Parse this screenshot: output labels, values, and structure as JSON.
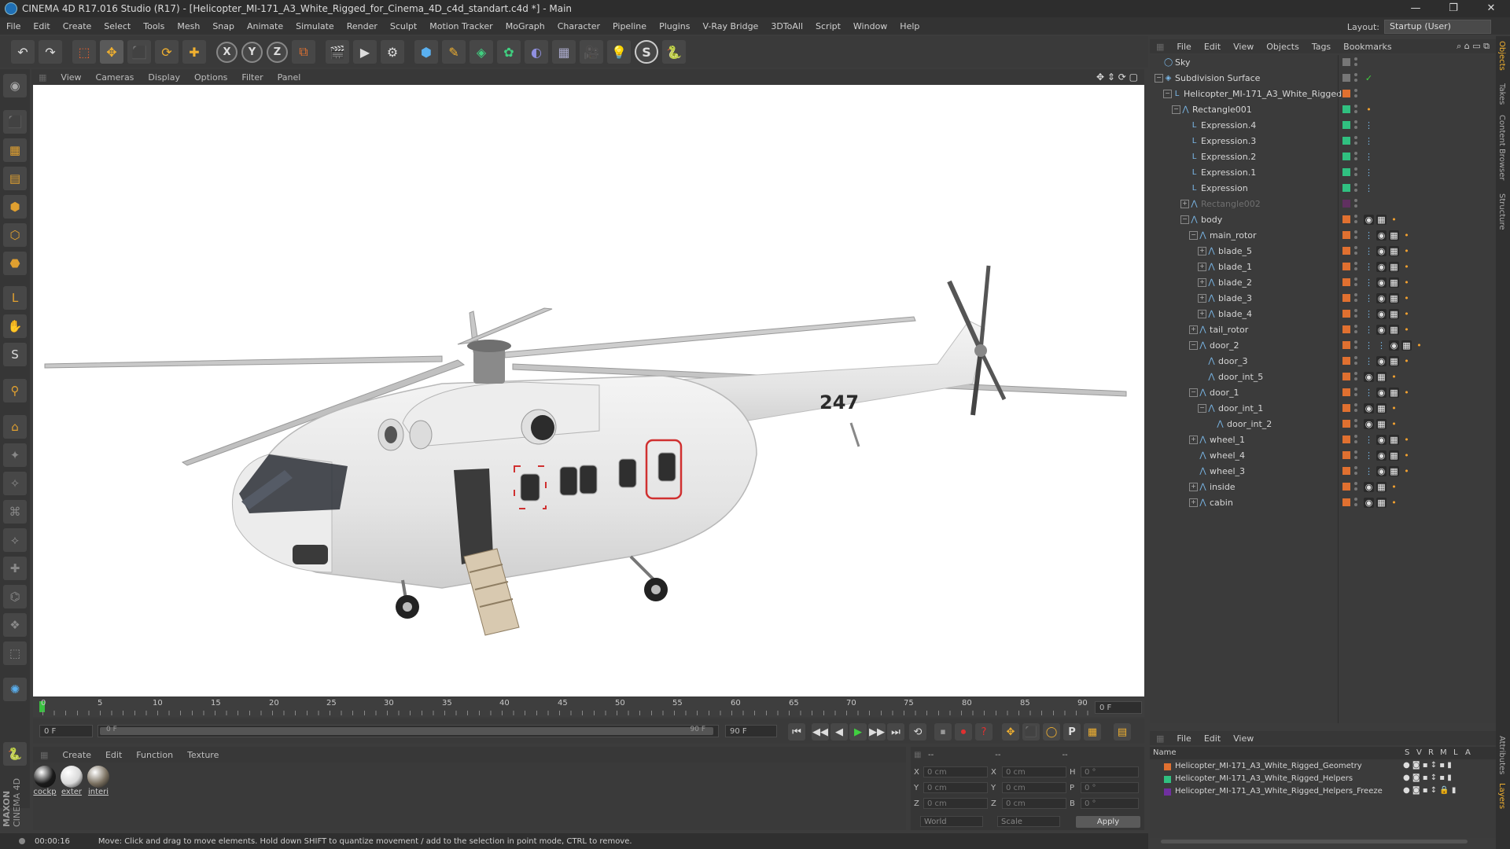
{
  "window": {
    "title": "CINEMA 4D R17.016 Studio (R17) - [Helicopter_MI-171_A3_White_Rigged_for_Cinema_4D_c4d_standart.c4d *] - Main",
    "minimize": "—",
    "restore": "❐",
    "close": "✕"
  },
  "menubar": {
    "items": [
      "File",
      "Edit",
      "Create",
      "Select",
      "Tools",
      "Mesh",
      "Snap",
      "Animate",
      "Simulate",
      "Render",
      "Sculpt",
      "Motion Tracker",
      "MoGraph",
      "Character",
      "Pipeline",
      "Plugins",
      "V-Ray Bridge",
      "3DToAll",
      "Script",
      "Window",
      "Help"
    ],
    "layout_label": "Layout:",
    "layout_value": "Startup (User)"
  },
  "toolbar": {
    "undo": "↶",
    "redo": "↷",
    "select": "⬚",
    "move": "✥",
    "scale": "⬛",
    "rotate": "⟳",
    "add": "✚",
    "x": "X",
    "y": "Y",
    "z": "Z",
    "coord": "⧉",
    "render_view": "🎬",
    "render": "▶",
    "render_settings": "⚙",
    "cube": "⬢",
    "pen": "✎",
    "subdiv": "◈",
    "array": "✿",
    "deformer": "◐",
    "floor": "▦",
    "camera": "🎥",
    "light": "💡",
    "vray": "S",
    "python": "🐍"
  },
  "left_tools": [
    "◉",
    "⬛",
    "▦",
    "▤",
    "⬢",
    "⬡",
    "⬣",
    "L",
    "✋",
    "S",
    "⚲",
    "⌂",
    "✦",
    "✧",
    "⌘",
    "⟡",
    "✚",
    "⌬",
    "❖",
    "⬚",
    "✺",
    "🐍"
  ],
  "viewport": {
    "menu": [
      "View",
      "Cameras",
      "Display",
      "Options",
      "Filter",
      "Panel"
    ],
    "nav_icons": "✥ ⇕ ⟳ ▢",
    "tail_number": "247"
  },
  "timeline": {
    "ticks": [
      "0",
      "5",
      "10",
      "15",
      "20",
      "25",
      "30",
      "35",
      "40",
      "45",
      "50",
      "55",
      "60",
      "65",
      "70",
      "75",
      "80",
      "85",
      "90"
    ],
    "frame_field": "0 F"
  },
  "transport": {
    "start_field": "0 F",
    "range_start": "0 F",
    "range_end": "90 F",
    "end_field": "90 F",
    "buttons": [
      "⏮",
      "◀◀",
      "◀",
      "▶",
      "▶▶",
      "⏭",
      "⟲",
      "⏹",
      "⏺",
      "?",
      "✥",
      "⬛",
      "◯",
      "P",
      "▦",
      "▤"
    ]
  },
  "materials": {
    "menu": [
      "Create",
      "Edit",
      "Function",
      "Texture"
    ],
    "items": [
      {
        "label": "cockp",
        "color": "#1a1a1a"
      },
      {
        "label": "exter",
        "color": "#d8d8d8"
      },
      {
        "label": "interi",
        "color": "#7a7060"
      }
    ]
  },
  "coords": {
    "header": [
      "--",
      "--",
      "--"
    ],
    "rows": [
      {
        "a": "X",
        "av": "0 cm",
        "b": "X",
        "bv": "0 cm",
        "c": "H",
        "cv": "0 °"
      },
      {
        "a": "Y",
        "av": "0 cm",
        "b": "Y",
        "bv": "0 cm",
        "c": "P",
        "cv": "0 °"
      },
      {
        "a": "Z",
        "av": "0 cm",
        "b": "Z",
        "bv": "0 cm",
        "c": "B",
        "cv": "0 °"
      }
    ],
    "world": "World",
    "scale": "Scale",
    "apply": "Apply"
  },
  "status": {
    "time": "00:00:16",
    "message": "Move: Click and drag to move elements. Hold down SHIFT to quantize movement / add to the selection in point mode, CTRL to remove."
  },
  "brand": {
    "line1": "MAXON",
    "line2": "CINEMA 4D"
  },
  "object_manager": {
    "menu": [
      "File",
      "Edit",
      "View",
      "Objects",
      "Tags",
      "Bookmarks"
    ],
    "rows": [
      {
        "name": "Sky",
        "indent": 0,
        "exp": "",
        "icon": "◯",
        "sw": "#777777",
        "tags": []
      },
      {
        "name": "Subdivision Surface",
        "indent": 0,
        "exp": "−",
        "icon": "◈",
        "sw": "#777777",
        "tags": [
          "✓"
        ]
      },
      {
        "name": "Helicopter_MI-171_A3_White_Rigged",
        "indent": 1,
        "exp": "−",
        "icon": "L",
        "sw": "#e07030",
        "tags": []
      },
      {
        "name": "Rectangle001",
        "indent": 2,
        "exp": "−",
        "icon": "⋀",
        "sw": "#30c080",
        "tags": [
          "•"
        ]
      },
      {
        "name": "Expression.4",
        "indent": 3,
        "exp": "",
        "icon": "L",
        "sw": "#30c080",
        "tags": [
          "⋮"
        ]
      },
      {
        "name": "Expression.3",
        "indent": 3,
        "exp": "",
        "icon": "L",
        "sw": "#30c080",
        "tags": [
          "⋮"
        ]
      },
      {
        "name": "Expression.2",
        "indent": 3,
        "exp": "",
        "icon": "L",
        "sw": "#30c080",
        "tags": [
          "⋮"
        ]
      },
      {
        "name": "Expression.1",
        "indent": 3,
        "exp": "",
        "icon": "L",
        "sw": "#30c080",
        "tags": [
          "⋮"
        ]
      },
      {
        "name": "Expression",
        "indent": 3,
        "exp": "",
        "icon": "L",
        "sw": "#30c080",
        "tags": [
          "⋮"
        ]
      },
      {
        "name": "Rectangle002",
        "indent": 3,
        "exp": "+",
        "icon": "⋀",
        "sw": "#603060",
        "tags": [],
        "dim": true
      },
      {
        "name": "body",
        "indent": 3,
        "exp": "−",
        "icon": "⋀",
        "sw": "#e07030",
        "tags": [
          "◉",
          "▦",
          "•"
        ]
      },
      {
        "name": "main_rotor",
        "indent": 4,
        "exp": "−",
        "icon": "⋀",
        "sw": "#e07030",
        "tags": [
          "⋮",
          "◉",
          "▦",
          "•"
        ]
      },
      {
        "name": "blade_5",
        "indent": 5,
        "exp": "+",
        "icon": "⋀",
        "sw": "#e07030",
        "tags": [
          "⋮",
          "◉",
          "▦",
          "•"
        ]
      },
      {
        "name": "blade_1",
        "indent": 5,
        "exp": "+",
        "icon": "⋀",
        "sw": "#e07030",
        "tags": [
          "⋮",
          "◉",
          "▦",
          "•"
        ]
      },
      {
        "name": "blade_2",
        "indent": 5,
        "exp": "+",
        "icon": "⋀",
        "sw": "#e07030",
        "tags": [
          "⋮",
          "◉",
          "▦",
          "•"
        ]
      },
      {
        "name": "blade_3",
        "indent": 5,
        "exp": "+",
        "icon": "⋀",
        "sw": "#e07030",
        "tags": [
          "⋮",
          "◉",
          "▦",
          "•"
        ]
      },
      {
        "name": "blade_4",
        "indent": 5,
        "exp": "+",
        "icon": "⋀",
        "sw": "#e07030",
        "tags": [
          "⋮",
          "◉",
          "▦",
          "•"
        ]
      },
      {
        "name": "tail_rotor",
        "indent": 4,
        "exp": "+",
        "icon": "⋀",
        "sw": "#e07030",
        "tags": [
          "⋮",
          "◉",
          "▦",
          "•"
        ]
      },
      {
        "name": "door_2",
        "indent": 4,
        "exp": "−",
        "icon": "⋀",
        "sw": "#e07030",
        "tags": [
          "⋮",
          "⋮",
          "◉",
          "▦",
          "•"
        ]
      },
      {
        "name": "door_3",
        "indent": 5,
        "exp": "",
        "icon": "⋀",
        "sw": "#e07030",
        "tags": [
          "⋮",
          "◉",
          "▦",
          "•"
        ]
      },
      {
        "name": "door_int_5",
        "indent": 5,
        "exp": "",
        "icon": "⋀",
        "sw": "#e07030",
        "tags": [
          "◉",
          "▦",
          "•"
        ]
      },
      {
        "name": "door_1",
        "indent": 4,
        "exp": "−",
        "icon": "⋀",
        "sw": "#e07030",
        "tags": [
          "⋮",
          "◉",
          "▦",
          "•"
        ]
      },
      {
        "name": "door_int_1",
        "indent": 5,
        "exp": "−",
        "icon": "⋀",
        "sw": "#e07030",
        "tags": [
          "◉",
          "▦",
          "•"
        ]
      },
      {
        "name": "door_int_2",
        "indent": 6,
        "exp": "",
        "icon": "⋀",
        "sw": "#e07030",
        "tags": [
          "◉",
          "▦",
          "•"
        ]
      },
      {
        "name": "wheel_1",
        "indent": 4,
        "exp": "+",
        "icon": "⋀",
        "sw": "#e07030",
        "tags": [
          "⋮",
          "◉",
          "▦",
          "•"
        ]
      },
      {
        "name": "wheel_4",
        "indent": 4,
        "exp": "",
        "icon": "⋀",
        "sw": "#e07030",
        "tags": [
          "⋮",
          "◉",
          "▦",
          "•"
        ]
      },
      {
        "name": "wheel_3",
        "indent": 4,
        "exp": "",
        "icon": "⋀",
        "sw": "#e07030",
        "tags": [
          "⋮",
          "◉",
          "▦",
          "•"
        ]
      },
      {
        "name": "inside",
        "indent": 4,
        "exp": "+",
        "icon": "⋀",
        "sw": "#e07030",
        "tags": [
          "◉",
          "▦",
          "•"
        ]
      },
      {
        "name": "cabin",
        "indent": 4,
        "exp": "+",
        "icon": "⋀",
        "sw": "#e07030",
        "tags": [
          "◉",
          "▦",
          "•"
        ]
      }
    ]
  },
  "layer_manager": {
    "menu": [
      "File",
      "Edit",
      "View"
    ],
    "head": {
      "name": "Name",
      "cols": [
        "S",
        "V",
        "R",
        "M",
        "L",
        "A"
      ]
    },
    "rows": [
      {
        "name": "Helicopter_MI-171_A3_White_Rigged_Geometry",
        "color": "#e07030"
      },
      {
        "name": "Helicopter_MI-171_A3_White_Rigged_Helpers",
        "color": "#30c080"
      },
      {
        "name": "Helicopter_MI-171_A3_White_Rigged_Helpers_Freeze",
        "color": "#7030a0"
      }
    ]
  },
  "right_tabs": [
    "Objects",
    "Takes",
    "Content Browser",
    "Structure",
    "Attributes",
    "Layers"
  ]
}
